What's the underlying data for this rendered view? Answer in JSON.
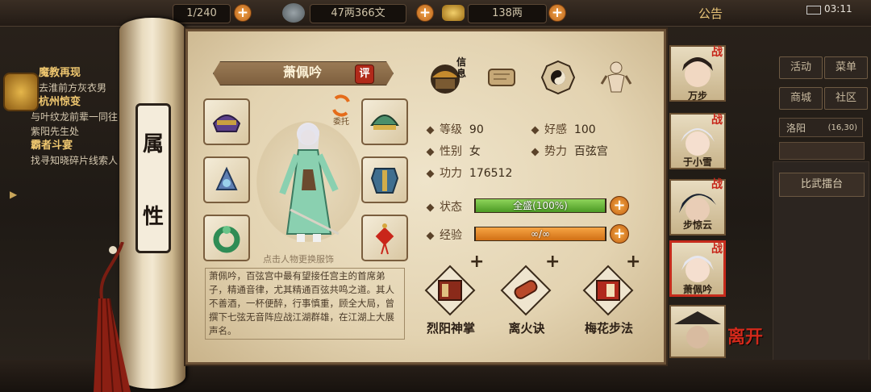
{
  "topbar": {
    "stamina": "1/240",
    "money": "47两366文",
    "gold": "138两",
    "notice": "公告",
    "clock": "03:11"
  },
  "quests": [
    {
      "title": "魔教再现",
      "desc": "去淮前方灰衣男"
    },
    {
      "title": "杭州惊变",
      "desc": "与叶纹龙前辈一同往紫阳先生处"
    },
    {
      "title": "霸者斗宴",
      "desc": "找寻知晓碎片线索人"
    }
  ],
  "right_menu": {
    "buttons": [
      "活动",
      "菜单",
      "商城",
      "社区"
    ],
    "location": "洛阳",
    "coords": "(16,30)",
    "arena": "比武擂台"
  },
  "scroll_label": [
    "属",
    "性"
  ],
  "hero": {
    "name": "萧佩吟",
    "rate_label": "评",
    "entrust_label": "委托",
    "outfit_tip": "点击人物更换服饰",
    "bio": "萧佩吟，百弦宫中最有望接任宫主的首席弟子，精通音律，尤其精通百弦共鸣之道。其人不善酒，一杯便醉，行事慎重，顾全大局，曾撰下七弦无音阵应战江湖群雄，在江湖上大展声名。",
    "tabs": [
      {
        "icon": "info-icon",
        "label": "信息"
      },
      {
        "icon": "scroll-icon",
        "label": ""
      },
      {
        "icon": "bagua-icon",
        "label": ""
      },
      {
        "icon": "meridian-icon",
        "label": ""
      }
    ],
    "stats": {
      "level_label": "等级",
      "level": "90",
      "favor_label": "好感",
      "favor": "100",
      "gender_label": "性别",
      "gender": "女",
      "faction_label": "势力",
      "faction": "百弦宫",
      "power_label": "功力",
      "power": "176512"
    },
    "status_label": "状态",
    "status_text": "全盛(100%)",
    "status_fill": 1.0,
    "exp_label": "经验",
    "exp_text": "∞/∞",
    "exp_fill": 1.0,
    "skills": [
      {
        "name": "烈阳神掌",
        "icon": "red-book-icon"
      },
      {
        "name": "离火诀",
        "icon": "scroll-icon"
      },
      {
        "name": "梅花步法",
        "icon": "red-book-icon"
      }
    ]
  },
  "roster": [
    {
      "name": "万步",
      "war": "战",
      "selected": false
    },
    {
      "name": "于小雪",
      "war": "战",
      "selected": false
    },
    {
      "name": "步惊云",
      "war": "战",
      "selected": false
    },
    {
      "name": "萧佩吟",
      "war": "战",
      "selected": true
    }
  ],
  "leave_label": "离开",
  "colors": {
    "status_bar": "#5fae2e",
    "exp_bar": "#e0801c",
    "accent_red": "#c7261a",
    "parchment": "#e8dcc0"
  }
}
